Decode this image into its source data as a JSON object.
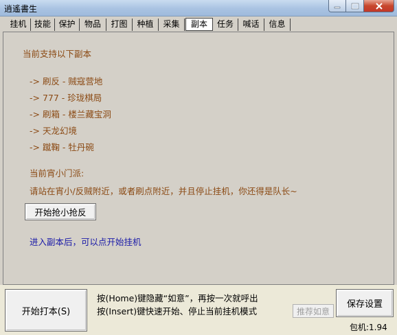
{
  "window": {
    "title": "逍遙書生"
  },
  "tabs": [
    {
      "label": "挂机"
    },
    {
      "label": "技能"
    },
    {
      "label": "保护"
    },
    {
      "label": "物品"
    },
    {
      "label": "打图"
    },
    {
      "label": "种植"
    },
    {
      "label": "采集"
    },
    {
      "label": "副本"
    },
    {
      "label": "任务"
    },
    {
      "label": "喊话"
    },
    {
      "label": "信息"
    }
  ],
  "active_tab": "副本",
  "main": {
    "heading": "当前支持以下副本",
    "dungeons": [
      "-> 刷反 - 贼寇营地",
      "-> 777 - 珍珑棋局",
      "-> 刷箱 - 楼兰藏宝洞",
      "-> 天龙幻境",
      "-> 蹴鞠 - 牡丹碗"
    ],
    "sect_label": "当前宵小门派:",
    "instruction": "请站在宵小/反贼附近，或者刷点附近，并且停止挂机，你还得是队长~",
    "start_grab_button": "开始抢小抢反",
    "hint": "进入副本后，可以点开始挂机"
  },
  "bottom": {
    "start_button": "开始打本(S)",
    "help_line1": "按(Home)键隐藏“如意”，再按一次就呼出",
    "help_line2": "按(Insert)键快速开始、停止当前挂机模式",
    "recommend_button": "推荐如意",
    "save_button": "保存设置",
    "version": "包机:1.94"
  },
  "colors": {
    "text_brown": "#8b4a14",
    "text_blue": "#1a1aa8",
    "panel_bg": "#d4d0c8"
  }
}
